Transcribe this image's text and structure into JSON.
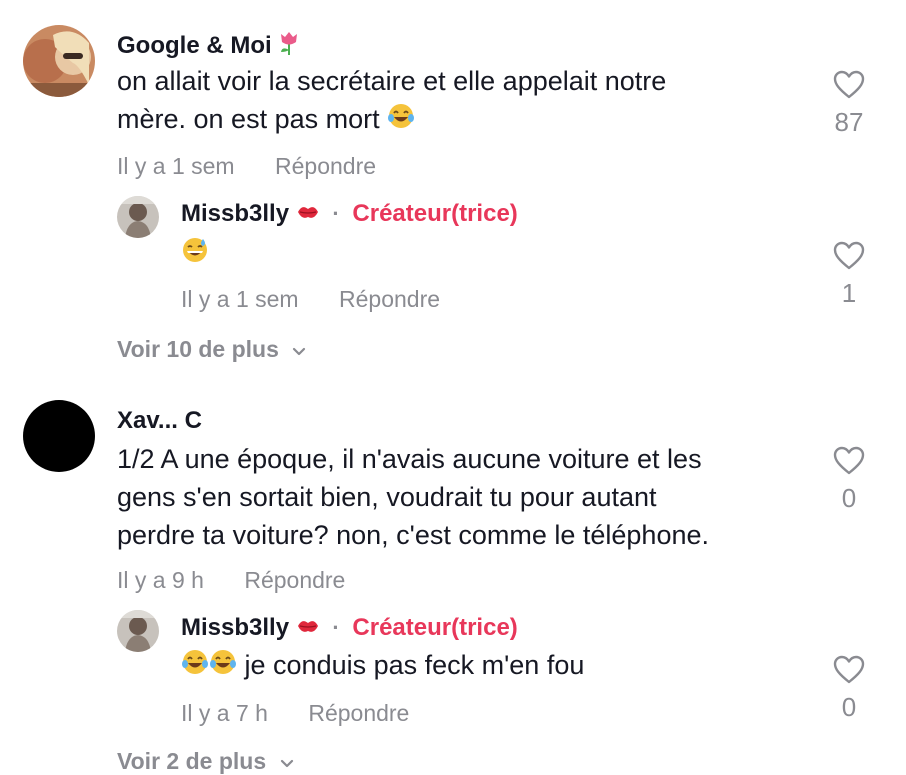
{
  "colors": {
    "accent": "#e8375a",
    "muted": "#8a8b91",
    "text": "#161823"
  },
  "comments": [
    {
      "username": "Google & Moi",
      "text_line1": "on allait voir la secrétaire et elle appelait notre",
      "text_line2": "mère. on est pas mort",
      "time": "Il y a 1 sem",
      "reply_label": "Répondre",
      "likes": "87",
      "reply": {
        "username": "Missb3lly",
        "badge": "Créateur(trice)",
        "time": "Il y a 1 sem",
        "reply_label": "Répondre",
        "likes": "1"
      },
      "more_label": "Voir 10 de plus"
    },
    {
      "username": "Xav... C",
      "text_line1": "1/2 A une époque, il n'avais aucune voiture et les",
      "text_line2": "gens s'en sortait bien, voudrait tu pour autant",
      "text_line3": "perdre ta voiture? non, c'est comme le téléphone.",
      "time": "Il y a 9 h",
      "reply_label": "Répondre",
      "likes": "0",
      "reply": {
        "username": "Missb3lly",
        "badge": "Créateur(trice)",
        "text": "je conduis pas feck m'en fou",
        "time": "Il y a 7 h",
        "reply_label": "Répondre",
        "likes": "0"
      },
      "more_label": "Voir 2 de plus"
    }
  ]
}
